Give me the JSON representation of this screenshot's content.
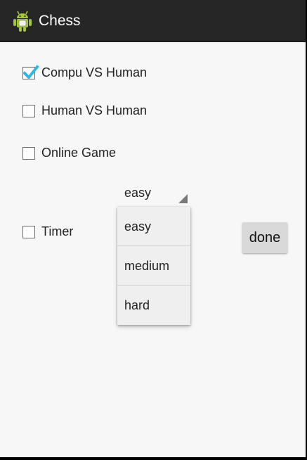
{
  "app": {
    "title": "Chess",
    "icon": "android-robot-icon"
  },
  "options": [
    {
      "label": "Compu VS Human",
      "checked": true
    },
    {
      "label": "Human VS Human",
      "checked": false
    },
    {
      "label": "Online Game",
      "checked": false
    },
    {
      "label": "Timer",
      "checked": false
    }
  ],
  "difficulty": {
    "selected": "easy",
    "options": [
      "easy",
      "medium",
      "hard"
    ]
  },
  "done_label": "done",
  "colors": {
    "actionbar": "#262626",
    "background": "#f7f7f7",
    "check_accent": "#33b5e5",
    "android_green": "#a4c639"
  }
}
